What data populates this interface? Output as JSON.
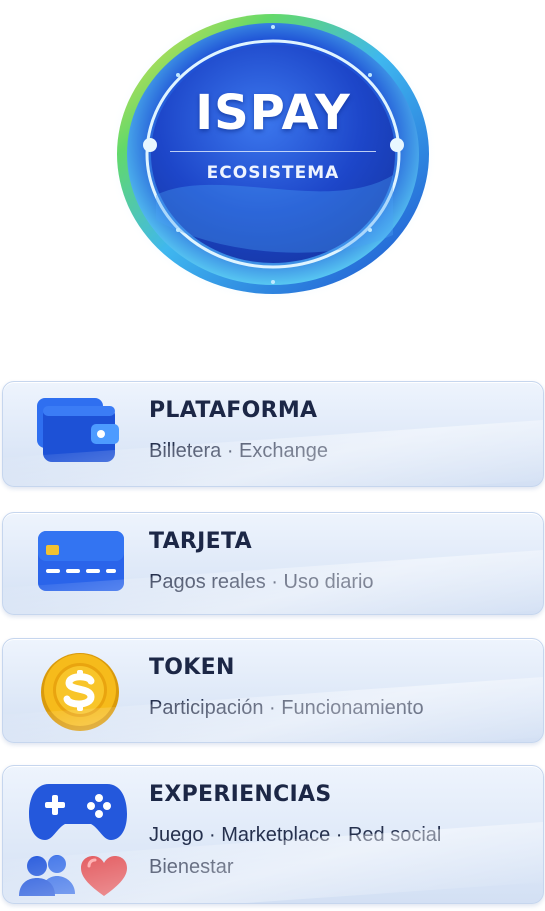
{
  "logo": {
    "title": "ISPAY",
    "subtitle": "ECOSISTEMA",
    "icon": "ispay-emblem"
  },
  "colors": {
    "brand_blue": "#1e4fd1",
    "ring_cyan": "#58d3ef",
    "ring_yellow": "#f5e04a",
    "card_bg": "#e3ecf9",
    "title_text": "#1c2746",
    "coin_gold": "#f2b418",
    "heart_red": "#e0494e"
  },
  "cards": [
    {
      "title": "PLATAFORMA",
      "description": "Billetera · Exchange",
      "icon": "wallet-icon"
    },
    {
      "title": "TARJETA",
      "description": "Pagos reales · Uso diario",
      "icon": "credit-card-icon"
    },
    {
      "title": "TOKEN",
      "description": "Participación · Funcionamiento",
      "icon": "coin-icon"
    },
    {
      "title": "EXPERIENCIAS",
      "description": "Juego · Marketplace · Red social",
      "description_line2": "Bienestar",
      "icons": [
        "gamepad-icon",
        "users-icon",
        "heart-icon"
      ]
    }
  ]
}
